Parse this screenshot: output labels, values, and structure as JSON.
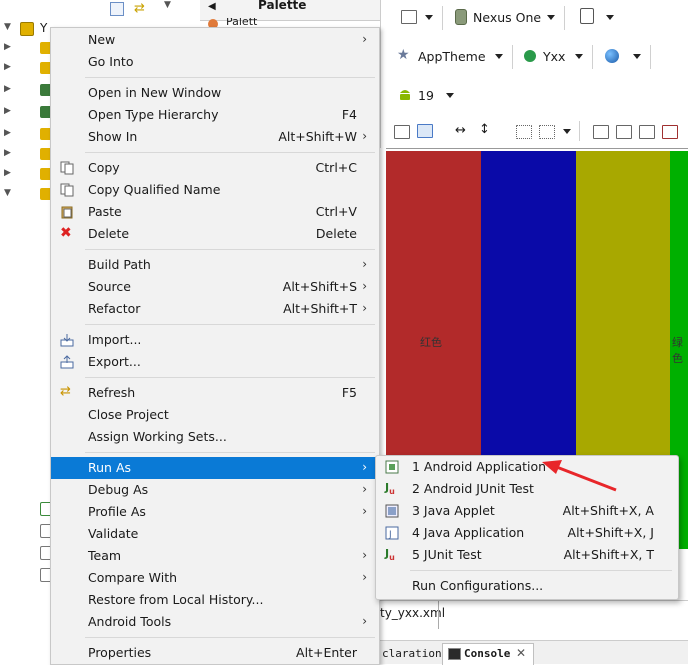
{
  "project": {
    "label": "Y"
  },
  "palette": {
    "title": "Palette",
    "partial_item": "Palett"
  },
  "toolbar": {
    "device": "Nexus One",
    "theme": "AppTheme",
    "activity": "Yxx",
    "api_level": "19"
  },
  "canvas": {
    "stripes": [
      {
        "color": "#b22a2a",
        "label": "红色"
      },
      {
        "color": "#0a0aa8",
        "label": ""
      },
      {
        "color": "#a8a800",
        "label": ""
      },
      {
        "color": "#00b000",
        "label": "绿色"
      }
    ]
  },
  "editor": {
    "file_tab": "ty_yxx.xml"
  },
  "bottom_tabs": {
    "declaration": "claration",
    "console": "Console"
  },
  "context_menu": {
    "items": [
      {
        "label": "New",
        "accel": "",
        "submenu": true
      },
      {
        "label": "Go Into",
        "accel": "",
        "submenu": false
      },
      {
        "label": "Open in New Window",
        "accel": "",
        "submenu": false
      },
      {
        "label": "Open Type Hierarchy",
        "accel": "F4",
        "submenu": false
      },
      {
        "label": "Show In",
        "accel": "Alt+Shift+W",
        "submenu": true
      },
      {
        "label": "Copy",
        "accel": "Ctrl+C",
        "submenu": false
      },
      {
        "label": "Copy Qualified Name",
        "accel": "",
        "submenu": false
      },
      {
        "label": "Paste",
        "accel": "Ctrl+V",
        "submenu": false
      },
      {
        "label": "Delete",
        "accel": "Delete",
        "submenu": false
      },
      {
        "label": "Build Path",
        "accel": "",
        "submenu": true
      },
      {
        "label": "Source",
        "accel": "Alt+Shift+S",
        "submenu": true
      },
      {
        "label": "Refactor",
        "accel": "Alt+Shift+T",
        "submenu": true
      },
      {
        "label": "Import...",
        "accel": "",
        "submenu": false
      },
      {
        "label": "Export...",
        "accel": "",
        "submenu": false
      },
      {
        "label": "Refresh",
        "accel": "F5",
        "submenu": false
      },
      {
        "label": "Close Project",
        "accel": "",
        "submenu": false
      },
      {
        "label": "Assign Working Sets...",
        "accel": "",
        "submenu": false
      },
      {
        "label": "Run As",
        "accel": "",
        "submenu": true
      },
      {
        "label": "Debug As",
        "accel": "",
        "submenu": true
      },
      {
        "label": "Profile As",
        "accel": "",
        "submenu": true
      },
      {
        "label": "Validate",
        "accel": "",
        "submenu": false
      },
      {
        "label": "Team",
        "accel": "",
        "submenu": true
      },
      {
        "label": "Compare With",
        "accel": "",
        "submenu": true
      },
      {
        "label": "Restore from Local History...",
        "accel": "",
        "submenu": false
      },
      {
        "label": "Android Tools",
        "accel": "",
        "submenu": true
      },
      {
        "label": "Properties",
        "accel": "Alt+Enter",
        "submenu": false
      }
    ]
  },
  "run_as_menu": {
    "items": [
      {
        "label": "1 Android Application",
        "accel": ""
      },
      {
        "label": "2 Android JUnit Test",
        "accel": ""
      },
      {
        "label": "3 Java Applet",
        "accel": "Alt+Shift+X, A"
      },
      {
        "label": "4 Java Application",
        "accel": "Alt+Shift+X, J"
      },
      {
        "label": "5 JUnit Test",
        "accel": "Alt+Shift+X, T"
      },
      {
        "label": "Run Configurations...",
        "accel": ""
      }
    ]
  },
  "colors": {
    "highlight": "#0a7ad6",
    "annotation": "#e8262a"
  }
}
